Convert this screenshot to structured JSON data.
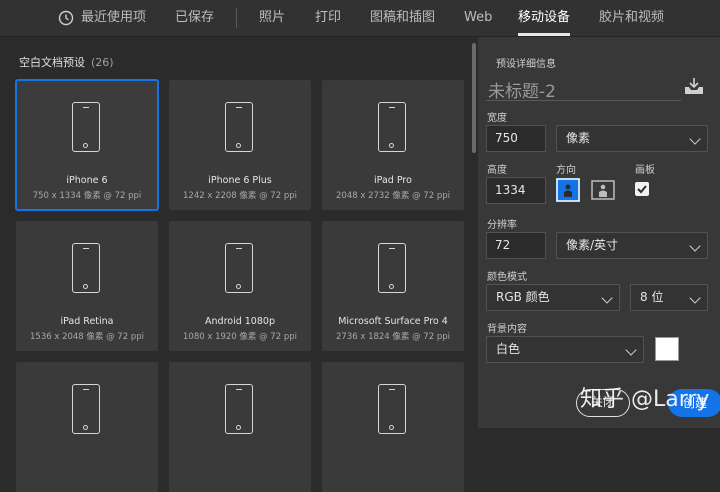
{
  "tabs": {
    "recent": "最近使用项",
    "saved": "已保存",
    "photo": "照片",
    "print": "打印",
    "art": "图稿和插图",
    "web": "Web",
    "mobile": "移动设备",
    "film": "胶片和视频"
  },
  "presets": {
    "title": "空白文档预设",
    "count": "(26)",
    "cards": [
      {
        "name": "iPhone 6",
        "size": "750 x 1334 像素 @ 72 ppi",
        "selected": true
      },
      {
        "name": "iPhone 6 Plus",
        "size": "1242 x 2208 像素 @ 72 ppi"
      },
      {
        "name": "iPad Pro",
        "size": "2048 x 2732 像素 @ 72 ppi"
      },
      {
        "name": "iPad Retina",
        "size": "1536 x 2048 像素 @ 72 ppi"
      },
      {
        "name": "Android 1080p",
        "size": "1080 x 1920 像素 @ 72 ppi"
      },
      {
        "name": "Microsoft Surface Pro 4",
        "size": "2736 x 1824 像素 @ 72 ppi"
      },
      {
        "name": "",
        "size": ""
      },
      {
        "name": "",
        "size": ""
      },
      {
        "name": "",
        "size": ""
      }
    ]
  },
  "details": {
    "header": "预设详细信息",
    "doc_title": "未标题-2",
    "width_label": "宽度",
    "width_value": "750",
    "width_unit": "像素",
    "height_label": "高度",
    "height_value": "1334",
    "orientation_label": "方向",
    "artboard_label": "画板",
    "resolution_label": "分辨率",
    "resolution_value": "72",
    "resolution_unit": "像素/英寸",
    "color_mode_label": "颜色模式",
    "color_mode_value": "RGB 颜色",
    "bit_depth": "8 位",
    "bg_label": "背景内容",
    "bg_value": "白色",
    "close_button": "关闭",
    "create_button": "创建"
  },
  "watermark": "知乎 @Larry",
  "colors": {
    "accent": "#1473e6",
    "panel": "#383838",
    "background": "#2b2b2b"
  }
}
